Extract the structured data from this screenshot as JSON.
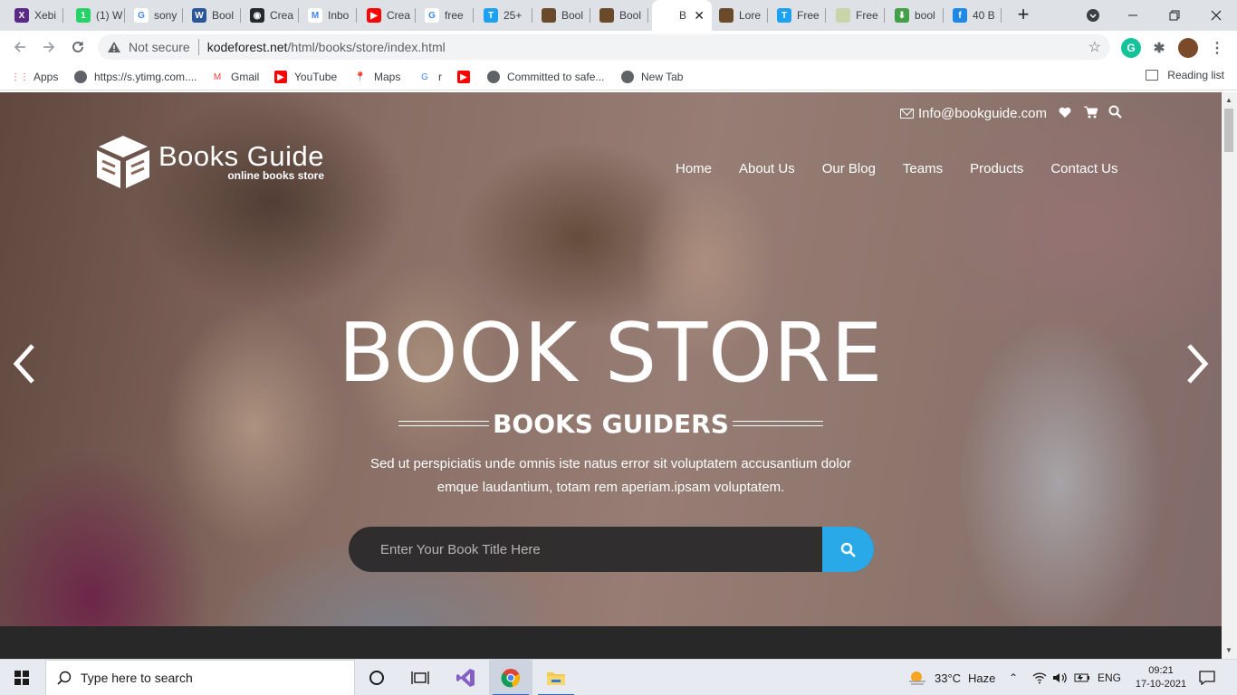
{
  "browser": {
    "tabs": [
      {
        "label": "Xebi",
        "icon": "xebia-icon",
        "color": "#5b2a86",
        "glyph": "X"
      },
      {
        "label": "(1) W",
        "icon": "whatsapp-icon",
        "color": "#25d366",
        "glyph": "1"
      },
      {
        "label": "sony",
        "icon": "google-icon",
        "color": "#ffffff",
        "glyph": "G"
      },
      {
        "label": "Bool",
        "icon": "word-icon",
        "color": "#2b579a",
        "glyph": "W"
      },
      {
        "label": "Crea",
        "icon": "github-icon",
        "color": "#24292e",
        "glyph": "◉"
      },
      {
        "label": "Inbo",
        "icon": "gmail-icon",
        "color": "#ffffff",
        "glyph": "M"
      },
      {
        "label": "Crea",
        "icon": "youtube-icon",
        "color": "#ff0000",
        "glyph": "▶"
      },
      {
        "label": "free",
        "icon": "google-icon",
        "color": "#ffffff",
        "glyph": "G"
      },
      {
        "label": "25+",
        "icon": "t-icon",
        "color": "#1da1f2",
        "glyph": "T"
      },
      {
        "label": "Bool",
        "icon": "book-cover-icon",
        "color": "#6b4a2b",
        "glyph": ""
      },
      {
        "label": "Bool",
        "icon": "book-cover-icon",
        "color": "#6b4a2b",
        "glyph": ""
      },
      {
        "label": "B",
        "icon": "",
        "color": "",
        "glyph": "",
        "active": true
      },
      {
        "label": "Lore",
        "icon": "book-cover-icon",
        "color": "#6b4a2b",
        "glyph": ""
      },
      {
        "label": "Free",
        "icon": "t-icon",
        "color": "#1da1f2",
        "glyph": "T"
      },
      {
        "label": "Free",
        "icon": "image-icon",
        "color": "#c9d4a8",
        "glyph": ""
      },
      {
        "label": "bool",
        "icon": "download-icon",
        "color": "#43a047",
        "glyph": "⬇"
      },
      {
        "label": "40 B",
        "icon": "f-icon",
        "color": "#1e88e5",
        "glyph": "f"
      }
    ],
    "security_label": "Not secure",
    "url_host": "kodeforest.net",
    "url_path": "/html/books/store/index.html",
    "bookmarks": [
      {
        "label": "Apps",
        "icon": "apps-icon"
      },
      {
        "label": "https://s.ytimg.com....",
        "icon": "globe-icon"
      },
      {
        "label": "Gmail",
        "icon": "gmail-icon"
      },
      {
        "label": "YouTube",
        "icon": "youtube-icon"
      },
      {
        "label": "Maps",
        "icon": "maps-icon"
      },
      {
        "label": "r",
        "icon": "google-icon"
      },
      {
        "label": "",
        "icon": "youtube-icon"
      },
      {
        "label": "Committed to safe...",
        "icon": "globe-icon"
      },
      {
        "label": "New Tab",
        "icon": "globe-icon"
      }
    ],
    "reading_list": "Reading list"
  },
  "site": {
    "email": "Info@bookguide.com",
    "logo_name": "Books Guide",
    "logo_tagline": "online books store",
    "menu": [
      "Home",
      "About Us",
      "Our Blog",
      "Teams",
      "Products",
      "Contact Us"
    ],
    "hero_title": "BOOK STORE",
    "hero_subtitle": "BOOKS GUIDERS",
    "hero_desc_line1": "Sed ut perspiciatis unde omnis iste natus error sit voluptatem accusantium dolor",
    "hero_desc_line2": "emque laudantium, totam rem aperiam.ipsam voluptatem.",
    "search_placeholder": "Enter Your Book Title Here",
    "accent": "#29a9e8"
  },
  "taskbar": {
    "search_placeholder": "Type here to search",
    "weather_temp": "33°C",
    "weather_cond": "Haze",
    "lang": "ENG",
    "time": "09:21",
    "date": "17-10-2021"
  }
}
